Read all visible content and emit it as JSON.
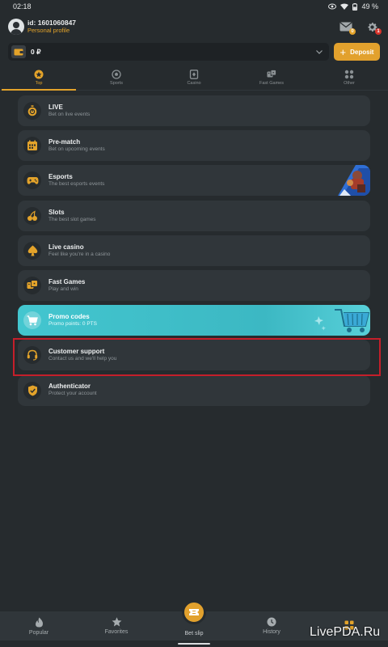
{
  "status_bar": {
    "time": "02:18",
    "battery": "49 %"
  },
  "profile": {
    "id": "id: 1601060847",
    "link": "Personal profile",
    "messages_badge": "0",
    "settings_badge": "1"
  },
  "balance": {
    "value": "0 ₽",
    "deposit_label": "Deposit"
  },
  "tabs": [
    {
      "label": "Top",
      "icon": "star-badge-icon",
      "active": true
    },
    {
      "label": "Sports",
      "icon": "ball-icon",
      "active": false
    },
    {
      "label": "Casino",
      "icon": "playing-card-icon",
      "active": false
    },
    {
      "label": "Fast Games",
      "icon": "dice-icon",
      "active": false
    },
    {
      "label": "Other",
      "icon": "dots-grid-icon",
      "active": false
    }
  ],
  "menu": [
    {
      "title": "LIVE",
      "subtitle": "Bet on live events",
      "icon": "stopwatch-icon"
    },
    {
      "title": "Pre-match",
      "subtitle": "Bet on upcoming events",
      "icon": "calendar-icon"
    },
    {
      "title": "Esports",
      "subtitle": "The best esports events",
      "icon": "gamepad-icon"
    },
    {
      "title": "Slots",
      "subtitle": "The best slot games",
      "icon": "cherries-icon"
    },
    {
      "title": "Live casino",
      "subtitle": "Feel like you're in a casino",
      "icon": "spade-icon"
    },
    {
      "title": "Fast Games",
      "subtitle": "Play and win",
      "icon": "dice-icon"
    },
    {
      "title": "Promo codes",
      "subtitle": "Promo points: 0 PTS",
      "icon": "cart-icon"
    },
    {
      "title": "Customer support",
      "subtitle": "Contact us and we'll help you",
      "icon": "headset-icon"
    },
    {
      "title": "Authenticator",
      "subtitle": "Protect your account",
      "icon": "shield-check-icon"
    }
  ],
  "bottom_nav": [
    {
      "label": "Popular",
      "icon": "flame-icon"
    },
    {
      "label": "Favorites",
      "icon": "star-icon"
    },
    {
      "label": "Bet slip",
      "icon": "ticket-icon"
    },
    {
      "label": "History",
      "icon": "clock-icon"
    },
    {
      "label": "",
      "icon": "apps-grid-icon"
    }
  ],
  "watermark": "LivePDA.Ru",
  "colors": {
    "accent": "#e3a32a",
    "background": "#262b2e",
    "card": "#30363a",
    "promo": "#43c6cf",
    "highlight": "#c51f2a"
  }
}
